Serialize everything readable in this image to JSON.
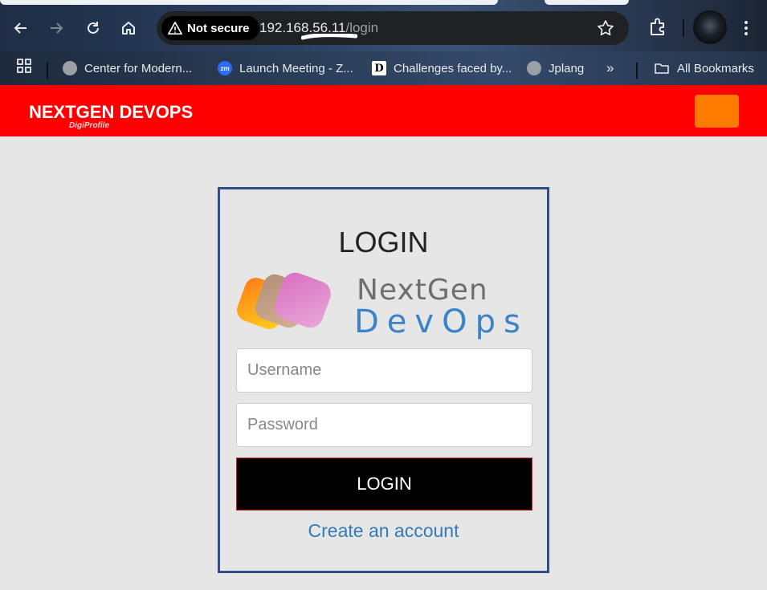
{
  "browser": {
    "security_label": "Not secure",
    "url_host": "192.168.56.11",
    "url_path": "/login",
    "icons": [
      "back-icon",
      "forward-icon",
      "reload-icon",
      "home-icon",
      "warning-icon",
      "star-icon",
      "extensions-icon",
      "avatar",
      "menu-icon",
      "apps-icon",
      "folder-icon"
    ]
  },
  "bookmarks": [
    {
      "label": "Center for Modern...",
      "icon": "globe-icon"
    },
    {
      "label": "Launch Meeting - Z...",
      "icon": "zoom-icon",
      "icon_text": "zm"
    },
    {
      "label": "Challenges faced by...",
      "icon": "d-icon",
      "icon_text": "D"
    },
    {
      "label": "Jplang",
      "icon": "globe-icon"
    }
  ],
  "bookmarks_overflow": "»",
  "all_bookmarks": "All Bookmarks",
  "site": {
    "brand": "NEXTGEN DEVOPS",
    "brand_sub": "DigiProfile",
    "header_color": "#ff0000",
    "menu_button_color": "#ff7a00"
  },
  "login": {
    "title": "LOGIN",
    "logo_line1": "NextGen",
    "logo_line2": "DevOps",
    "username_placeholder": "Username",
    "password_placeholder": "Password",
    "button_label": "LOGIN",
    "create_account": "Create an account"
  }
}
